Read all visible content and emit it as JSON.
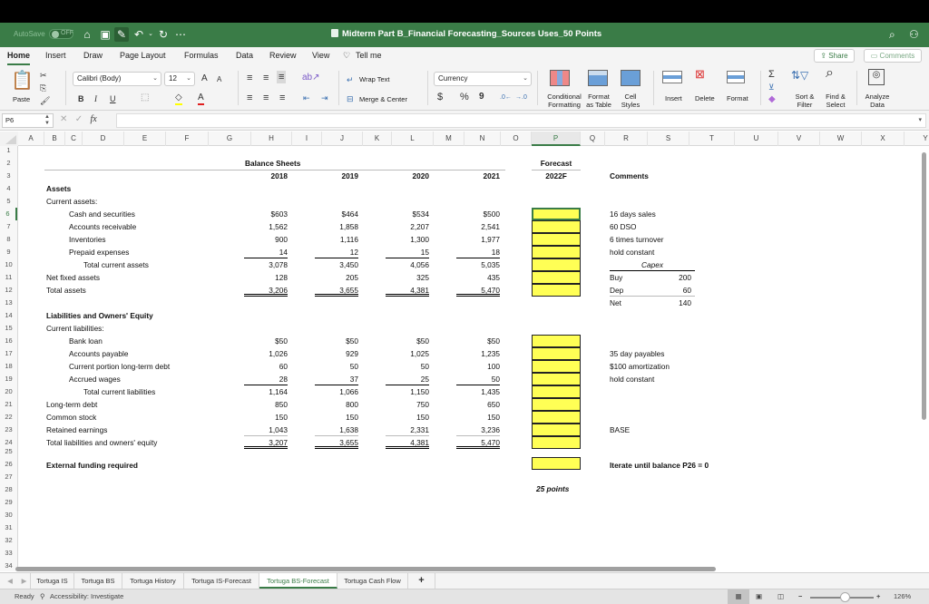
{
  "titlebar": {
    "autosave_label": "AutoSave",
    "autosave_state": "OFF",
    "title": "Midterm Part B_Financial Forecasting_Sources Uses_50 Points",
    "icons": [
      "home-icon",
      "save-icon",
      "edit-save-icon",
      "undo-icon",
      "redo-icon",
      "more-icon",
      "search-icon",
      "collaborate-icon"
    ]
  },
  "menu": {
    "items": [
      "Home",
      "Insert",
      "Draw",
      "Page Layout",
      "Formulas",
      "Data",
      "Review",
      "View",
      "Tell me"
    ],
    "active": "Home",
    "share_label": "Share",
    "comments_label": "Comments"
  },
  "ribbon": {
    "paste_label": "Paste",
    "font_name": "Calibri (Body)",
    "font_size": "12",
    "bold": "B",
    "italic": "I",
    "underline": "U",
    "wrap_text": "Wrap Text",
    "merge_center": "Merge & Center",
    "number_format": "Currency",
    "currency_symbol": "$",
    "percent_symbol": "%",
    "comma_symbol": "9",
    "conditional_formatting": [
      "Conditional",
      "Formatting"
    ],
    "format_as_table": [
      "Format",
      "as Table"
    ],
    "cell_styles": [
      "Cell",
      "Styles"
    ],
    "insert": "Insert",
    "delete": "Delete",
    "format": "Format",
    "sort_filter": [
      "Sort &",
      "Filter"
    ],
    "find_select": [
      "Find &",
      "Select"
    ],
    "analyze_data": [
      "Analyze",
      "Data"
    ],
    "fill_color": "#ffff00",
    "font_color": "#e02020"
  },
  "formula_bar": {
    "name_box": "P6",
    "fx": "fx",
    "value": ""
  },
  "columns": [
    "A",
    "B",
    "C",
    "D",
    "E",
    "F",
    "G",
    "H",
    "I",
    "J",
    "K",
    "L",
    "M",
    "N",
    "O",
    "P",
    "Q",
    "R",
    "S",
    "T",
    "U",
    "V",
    "W",
    "X",
    "Y"
  ],
  "selected_column": "P",
  "rows": [
    1,
    2,
    3,
    4,
    5,
    6,
    7,
    8,
    9,
    10,
    11,
    12,
    13,
    14,
    15,
    16,
    17,
    18,
    19,
    20,
    21,
    22,
    23,
    24,
    25,
    26,
    27,
    28,
    29,
    30,
    31,
    32,
    33,
    34
  ],
  "selected_row": 6,
  "sheet": {
    "header_title": "Balance Sheets",
    "forecast_label": "Forecast",
    "years": [
      "2018",
      "2019",
      "2020",
      "2021"
    ],
    "forecast_year": "2022F",
    "comments_header": "Comments",
    "assets_label": "Assets",
    "current_assets_label": "Current assets:",
    "asset_rows": [
      {
        "label": "Cash and securities",
        "values": [
          "$603",
          "$464",
          "$534",
          "$500"
        ],
        "comment": "16 days sales"
      },
      {
        "label": "Accounts receivable",
        "values": [
          "1,562",
          "1,858",
          "2,207",
          "2,541"
        ],
        "comment": "60 DSO"
      },
      {
        "label": "Inventories",
        "values": [
          "900",
          "1,116",
          "1,300",
          "1,977"
        ],
        "comment": "6 times turnover"
      },
      {
        "label": "Prepaid expenses",
        "values": [
          "14",
          "12",
          "15",
          "18"
        ],
        "comment": "hold constant"
      },
      {
        "label": "Total current assets",
        "values": [
          "3,078",
          "3,450",
          "4,056",
          "5,035"
        ],
        "comment": ""
      },
      {
        "label": "Net fixed assets",
        "values": [
          "128",
          "205",
          "325",
          "435"
        ],
        "comment": ""
      },
      {
        "label": "Total assets",
        "values": [
          "3,206",
          "3,655",
          "4,381",
          "5,470"
        ],
        "comment": ""
      }
    ],
    "capex": {
      "title": "Capex",
      "rows": [
        {
          "label": "Buy",
          "value": "200"
        },
        {
          "label": "Dep",
          "value": "60"
        },
        {
          "label": "Net",
          "value": "140"
        }
      ]
    },
    "liabilities_label": "Liabilities and Owners' Equity",
    "current_liabilities_label": "Current liabilities:",
    "liability_rows": [
      {
        "label": "Bank loan",
        "values": [
          "$50",
          "$50",
          "$50",
          "$50"
        ],
        "comment": ""
      },
      {
        "label": "Accounts payable",
        "values": [
          "1,026",
          "929",
          "1,025",
          "1,235"
        ],
        "comment": "35 day payables"
      },
      {
        "label": "Current portion long-term debt",
        "values": [
          "60",
          "50",
          "50",
          "100"
        ],
        "comment": "$100 amortization"
      },
      {
        "label": "Accrued wages",
        "values": [
          "28",
          "37",
          "25",
          "50"
        ],
        "comment": "hold constant"
      },
      {
        "label": "Total current liabilities",
        "values": [
          "1,164",
          "1,066",
          "1,150",
          "1,435"
        ],
        "comment": ""
      },
      {
        "label": "Long-term debt",
        "values": [
          "850",
          "800",
          "750",
          "650"
        ],
        "comment": ""
      },
      {
        "label": "Common stock",
        "values": [
          "150",
          "150",
          "150",
          "150"
        ],
        "comment": ""
      },
      {
        "label": "Retained earnings",
        "values": [
          "1,043",
          "1,638",
          "2,331",
          "3,236"
        ],
        "comment": "BASE"
      },
      {
        "label": "Total liabilities and owners' equity",
        "values": [
          "3,207",
          "3,655",
          "4,381",
          "5,470"
        ],
        "comment": ""
      }
    ],
    "external_funding_label": "External funding required",
    "external_funding_comment": "Iterate until balance P26 = 0",
    "points_note": "25 points",
    "input_cell_color": "#ffff55"
  },
  "sheet_tabs": [
    "Tortuga IS",
    "Tortuga BS",
    "Tortuga History",
    "Tortuga IS-Forecast",
    "Tortuga BS-Forecast",
    "Tortuga Cash Flow"
  ],
  "active_tab": "Tortuga BS-Forecast",
  "add_sheet": "+",
  "status": {
    "ready": "Ready",
    "accessibility": "Accessibility: Investigate",
    "zoom": "126%",
    "zoom_minus": "−",
    "zoom_plus": "+"
  }
}
